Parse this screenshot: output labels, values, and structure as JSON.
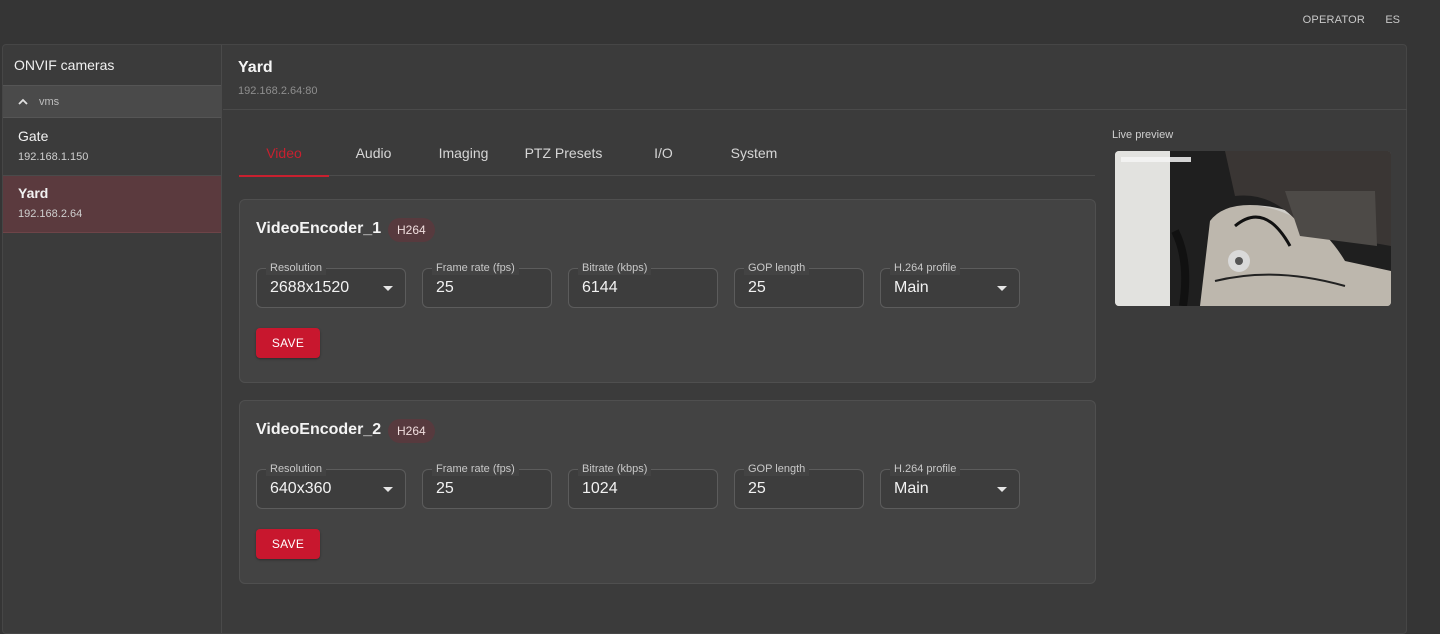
{
  "topbar": {
    "user": "OPERATOR",
    "language": "ES"
  },
  "sidebar": {
    "title": "ONVIF cameras",
    "group": "vms",
    "cameras": [
      {
        "name": "Gate",
        "ip": "192.168.1.150"
      },
      {
        "name": "Yard",
        "ip": "192.168.2.64",
        "selected": true
      }
    ]
  },
  "camera": {
    "name": "Yard",
    "address": "192.168.2.64:80"
  },
  "tabs": [
    "Video",
    "Audio",
    "Imaging",
    "PTZ Presets",
    "I/O",
    "System"
  ],
  "active_tab": "Video",
  "preview": {
    "label": "Live preview"
  },
  "field_labels": {
    "resolution": "Resolution",
    "frame_rate": "Frame rate (fps)",
    "bitrate": "Bitrate (kbps)",
    "gop": "GOP length",
    "profile": "H.264 profile"
  },
  "encoders": [
    {
      "name": "VideoEncoder_1",
      "codec": "H264",
      "resolution": "2688x1520",
      "frame_rate": "25",
      "bitrate": "6144",
      "gop": "25",
      "profile": "Main",
      "save_label": "SAVE"
    },
    {
      "name": "VideoEncoder_2",
      "codec": "H264",
      "resolution": "640x360",
      "frame_rate": "25",
      "bitrate": "1024",
      "gop": "25",
      "profile": "Main",
      "save_label": "SAVE"
    }
  ],
  "colors": {
    "accent": "#c8172e",
    "selected_bg": "#5b3a3e",
    "badge_bg": "#573a3e"
  },
  "icons": {
    "group_toggle": "chevron-up-icon",
    "select": "caret-down-icon"
  }
}
